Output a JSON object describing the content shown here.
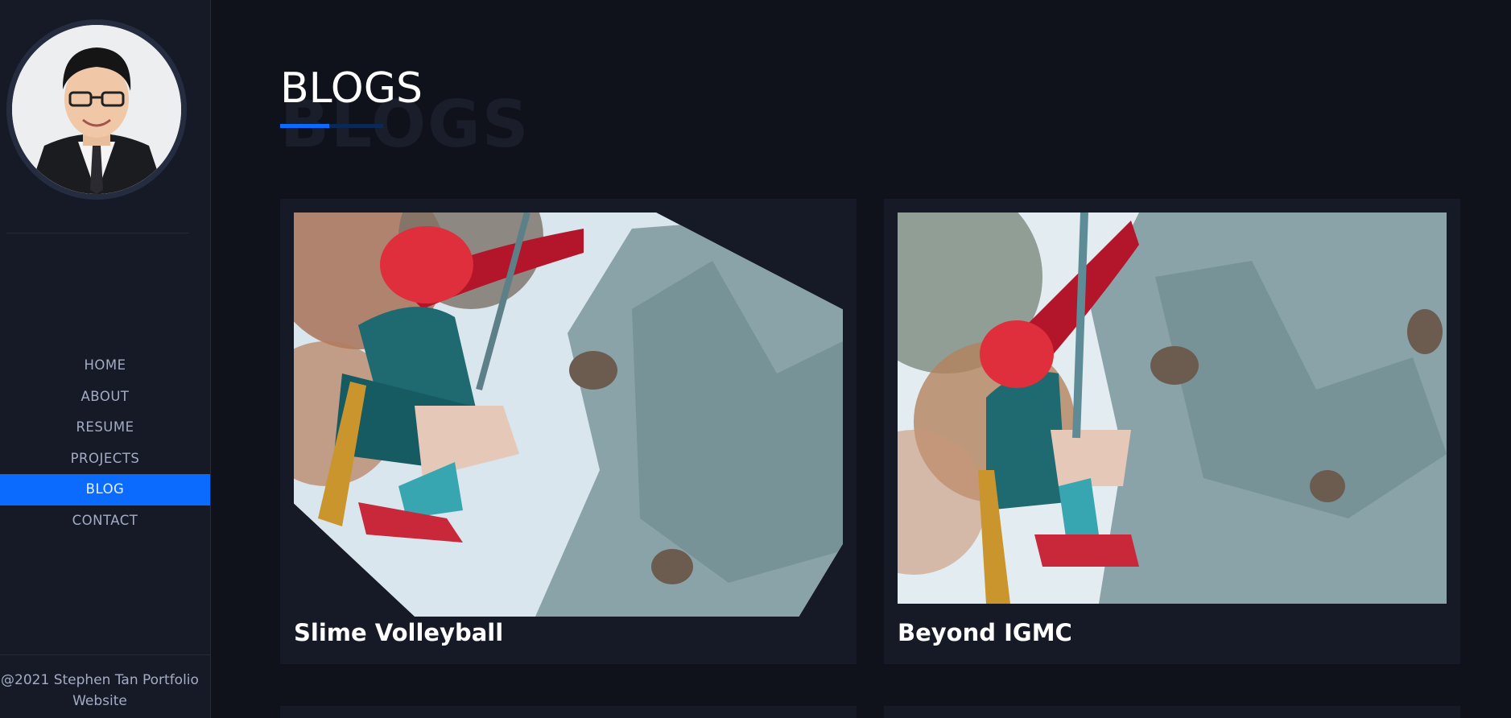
{
  "sidebar": {
    "nav": [
      {
        "label": "HOME"
      },
      {
        "label": "ABOUT"
      },
      {
        "label": "RESUME"
      },
      {
        "label": "PROJECTS"
      },
      {
        "label": "BLOG"
      },
      {
        "label": "CONTACT"
      }
    ],
    "active_item": "BLOG",
    "footer": "@2021 Stephen Tan Portfolio Website"
  },
  "main": {
    "title": "BLOGS",
    "title_shadow": "BLOGS",
    "posts": [
      {
        "title": "Slime Volleyball"
      },
      {
        "title": "Beyond IGMC"
      }
    ]
  },
  "colors": {
    "background": "#10121b",
    "sidebar": "#161a26",
    "card": "#161a26",
    "accent": "#0c6bff",
    "nav_text": "#a4acc4"
  }
}
